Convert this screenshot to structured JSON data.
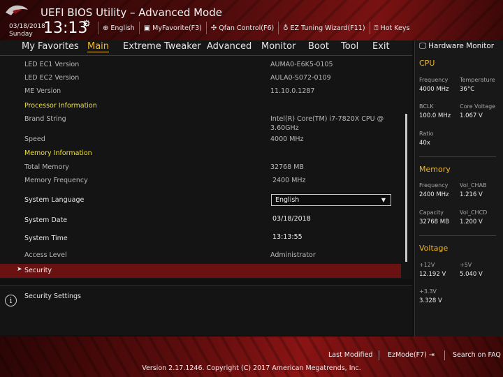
{
  "header": {
    "title": "UEFI BIOS Utility – Advanced Mode",
    "date": "03/18/2018",
    "weekday": "Sunday",
    "time": "13:13",
    "toolbar": [
      {
        "icon": "globe-icon",
        "label": "English"
      },
      {
        "icon": "favorite-icon",
        "label": "MyFavorite(F3)"
      },
      {
        "icon": "fan-icon",
        "label": "Qfan Control(F6)"
      },
      {
        "icon": "lightbulb-icon",
        "label": "EZ Tuning Wizard(F11)"
      },
      {
        "icon": "help-icon",
        "label": "Hot Keys"
      }
    ]
  },
  "tabs": [
    "My Favorites",
    "Main",
    "Extreme Tweaker",
    "Advanced",
    "Monitor",
    "Boot",
    "Tool",
    "Exit"
  ],
  "active_tab": "Main",
  "main": {
    "led_ec1_label": "LED EC1 Version",
    "led_ec1_value": "AUMA0-E6K5-0105",
    "led_ec2_label": "LED EC2 Version",
    "led_ec2_value": "AULA0-S072-0109",
    "me_label": "ME Version",
    "me_value": "11.10.0.1287",
    "processor_section": "Processor Information",
    "brand_label": "Brand String",
    "brand_value_line1": "Intel(R) Core(TM) i7-7820X CPU @",
    "brand_value_line2": "3.60GHz",
    "speed_label": "Speed",
    "speed_value": "4000 MHz",
    "memory_section": "Memory Information",
    "total_mem_label": "Total Memory",
    "total_mem_value": "32768 MB",
    "mem_freq_label": "Memory Frequency",
    "mem_freq_value": "2400 MHz",
    "language_label": "System Language",
    "language_value": "English",
    "date_label": "System Date",
    "date_value": "03/18/2018",
    "time_label": "System Time",
    "time_value": "13:13:55",
    "access_label": "Access Level",
    "access_value": "Administrator",
    "security_label": "Security"
  },
  "help": {
    "text": "Security Settings"
  },
  "hardware_monitor": {
    "title": "Hardware Monitor",
    "cpu": {
      "title": "CPU",
      "frequency_label": "Frequency",
      "frequency_value": "4000 MHz",
      "temperature_label": "Temperature",
      "temperature_value": "36°C",
      "bclk_label": "BCLK",
      "bclk_value": "100.0 MHz",
      "core_voltage_label": "Core Voltage",
      "core_voltage_value": "1.067 V",
      "ratio_label": "Ratio",
      "ratio_value": "40x"
    },
    "memory": {
      "title": "Memory",
      "frequency_label": "Frequency",
      "frequency_value": "2400 MHz",
      "vol_chab_label": "Vol_CHAB",
      "vol_chab_value": "1.216 V",
      "capacity_label": "Capacity",
      "capacity_value": "32768 MB",
      "vol_chcd_label": "Vol_CHCD",
      "vol_chcd_value": "1.200 V"
    },
    "voltage": {
      "title": "Voltage",
      "v12_label": "+12V",
      "v12_value": "12.192 V",
      "v5_label": "+5V",
      "v5_value": "5.040 V",
      "v33_label": "+3.3V",
      "v33_value": "3.328 V"
    }
  },
  "footer": {
    "last_modified": "Last Modified",
    "ezmode": "EzMode(F7)",
    "search": "Search on FAQ",
    "copyright": "Version 2.17.1246. Copyright (C) 2017 American Megatrends, Inc."
  },
  "colors": {
    "accent": "#f5b922",
    "section": "#f0e132",
    "selection": "#6a1212"
  }
}
